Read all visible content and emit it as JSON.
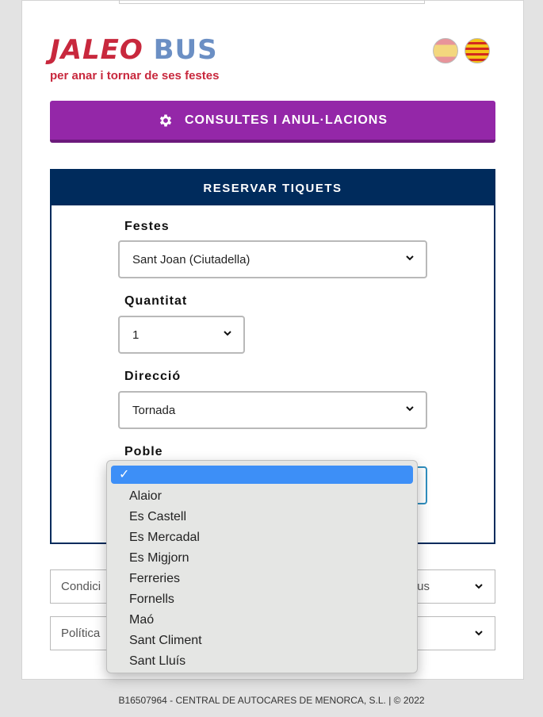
{
  "brand": {
    "word1": "JALEO",
    "word2": "BUS",
    "tagline": "per anar i tornar de ses festes"
  },
  "languages": [
    {
      "name": "Castellano",
      "icon": "spain-flag-icon"
    },
    {
      "name": "Català",
      "icon": "catalonia-flag-icon"
    }
  ],
  "consult_button": {
    "label": "CONSULTES I ANUL·LACIONS",
    "icon": "gear-icon"
  },
  "reserve": {
    "title": "RESERVAR TIQUETS",
    "fields": {
      "festes": {
        "label": "Festes",
        "value": "Sant Joan (Ciutadella)"
      },
      "quantitat": {
        "label": "Quantitat",
        "value": "1"
      },
      "direccio": {
        "label": "Direcció",
        "value": "Tornada"
      },
      "poble": {
        "label": "Poble",
        "value": ""
      }
    }
  },
  "accordions": {
    "conditions": {
      "label": "Condici",
      "tail": "us"
    },
    "policy": {
      "label": "Política"
    }
  },
  "dropdown": {
    "check": "✓",
    "options": [
      "Alaior",
      "Es Castell",
      "Es Mercadal",
      "Es Migjorn",
      "Ferreries",
      "Fornells",
      "Maó",
      "Sant Climent",
      "Sant Lluís"
    ]
  },
  "footer": {
    "text": "B16507964 - CENTRAL DE AUTOCARES DE MENORCA, S.L. | © 2022"
  },
  "colors": {
    "brand_red": "#c8283d",
    "brand_blue": "#6b8fc4",
    "purple": "#9427a8",
    "navy": "#002b5c",
    "highlight": "#3d8ff7"
  }
}
